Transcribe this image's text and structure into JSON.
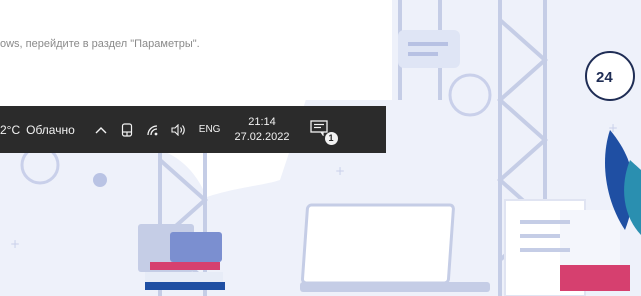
{
  "notice": {
    "text": "ows, перейдите в раздел \"Параметры\"."
  },
  "taskbar": {
    "temperature": "2°C",
    "condition": "Облачно",
    "language": "ENG",
    "time": "21:14",
    "date": "27.02.2022",
    "notification_count": "1"
  },
  "illustration": {
    "badge_text": "24",
    "accent_colors": [
      "#1f4fa3",
      "#2a8fb0",
      "#d6406f",
      "#e7ecf7"
    ]
  }
}
